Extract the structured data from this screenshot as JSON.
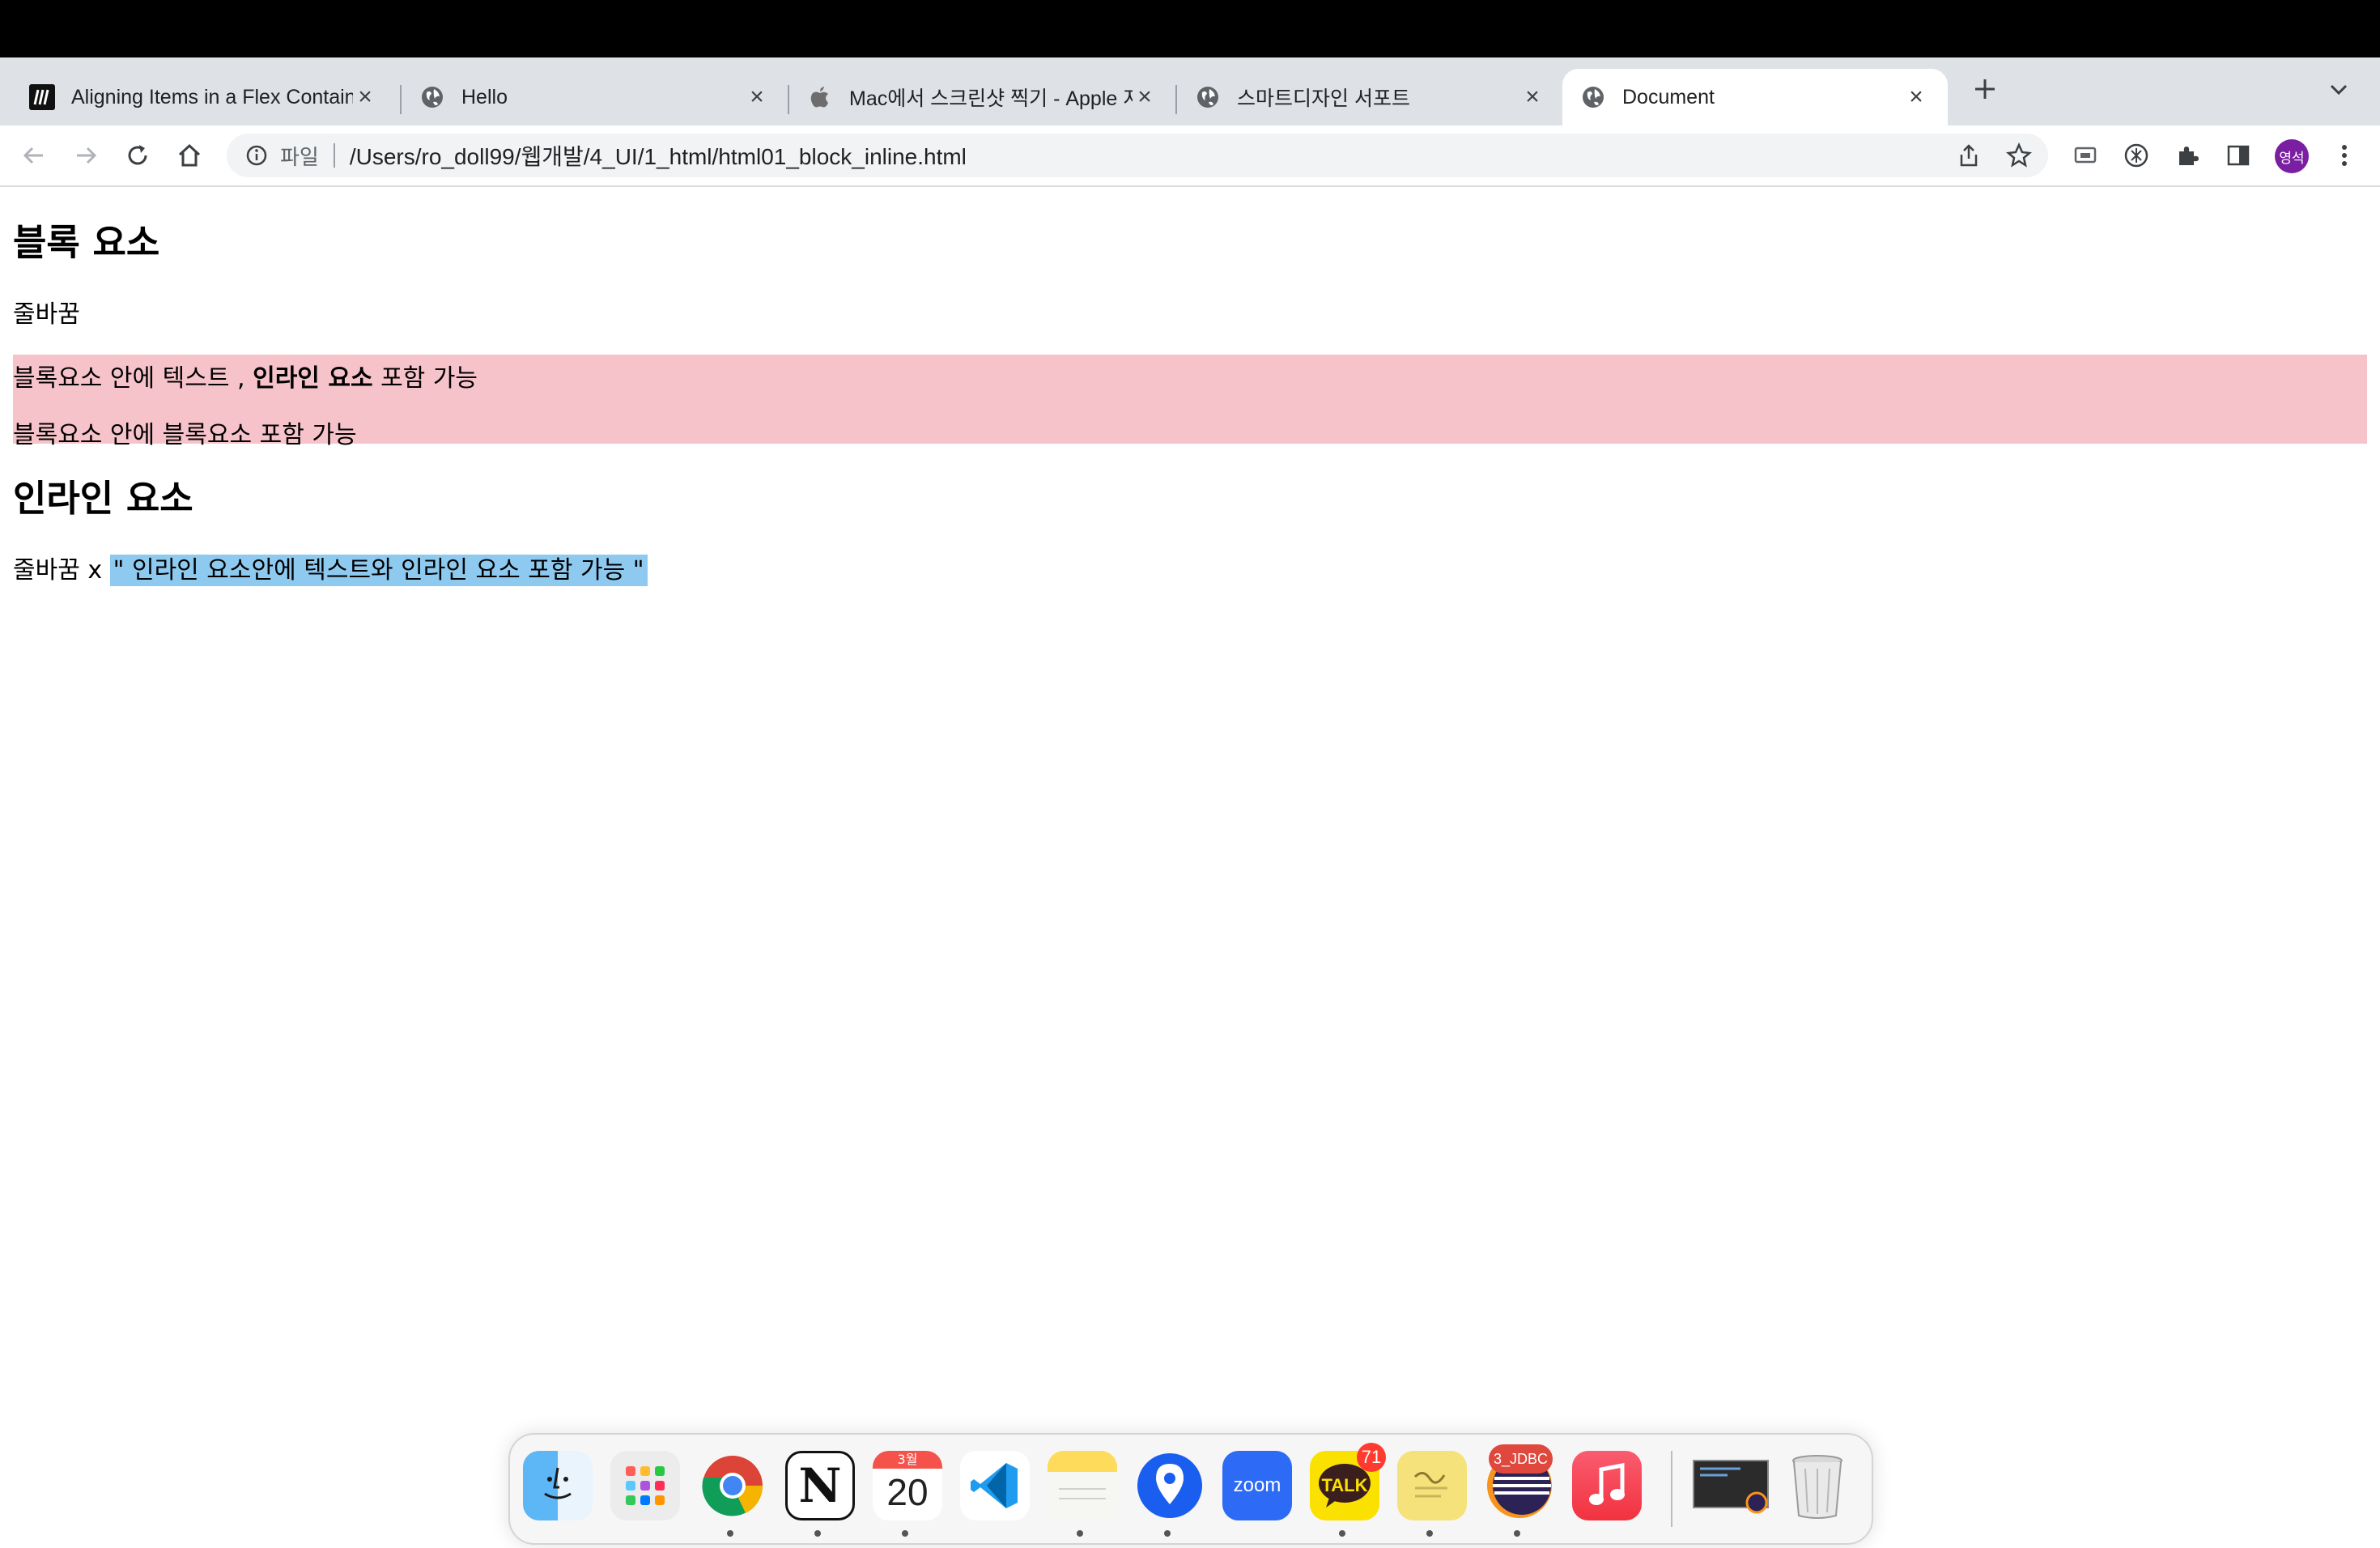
{
  "browser": {
    "tabs": [
      {
        "title": "Aligning Items in a Flex Container | CSS",
        "favicon": "mdn-logo-icon"
      },
      {
        "title": "Hello",
        "favicon": "globe-icon"
      },
      {
        "title": "Mac에서 스크린샷 찍기 - Apple 지원",
        "favicon": "apple-icon"
      },
      {
        "title": "스마트디자인 서포트",
        "favicon": "globe-icon"
      },
      {
        "title": "Document",
        "favicon": "globe-icon",
        "active": true
      }
    ],
    "close_glyph": "×",
    "omnibox": {
      "scheme_label": "파일",
      "url": "/Users/ro_doll99/웹개발/4_UI/1_html/html01_block_inline.html"
    },
    "profile_initials": "영석",
    "profile_color": "#7b1fa2"
  },
  "page": {
    "block_heading": "블록 요소",
    "block_desc": "줄바꿈",
    "block_line1_before": "블록요소 안에 텍스트 , ",
    "block_line1_bold": "인라인 요소",
    "block_line1_after": " 포함 가능",
    "block_line2": "블록요소 안에 블록요소 포함 가능",
    "block_bg": "#f7c3ca",
    "inline_heading": "인라인 요소",
    "inline_desc": "줄바꿈 x ",
    "inline_span": "\" 인라인 요소안에 텍스트와 인라인 요소 포함 가능 \"",
    "inline_bg": "#8ecaf0"
  },
  "dock": {
    "items": [
      {
        "name": "finder"
      },
      {
        "name": "launchpad"
      },
      {
        "name": "chrome"
      },
      {
        "name": "notion",
        "label": "N"
      },
      {
        "name": "calendar",
        "month": "3월",
        "day": "20"
      },
      {
        "name": "vscode"
      },
      {
        "name": "notes"
      },
      {
        "name": "maps-pin"
      },
      {
        "name": "zoom",
        "label": "zoom"
      },
      {
        "name": "kakaotalk",
        "label": "TALK",
        "badge": "71"
      },
      {
        "name": "stickies"
      },
      {
        "name": "eclipse",
        "badge": "3_JDBC"
      },
      {
        "name": "music"
      },
      {
        "name": "screen-thumbnail"
      },
      {
        "name": "trash"
      }
    ]
  }
}
